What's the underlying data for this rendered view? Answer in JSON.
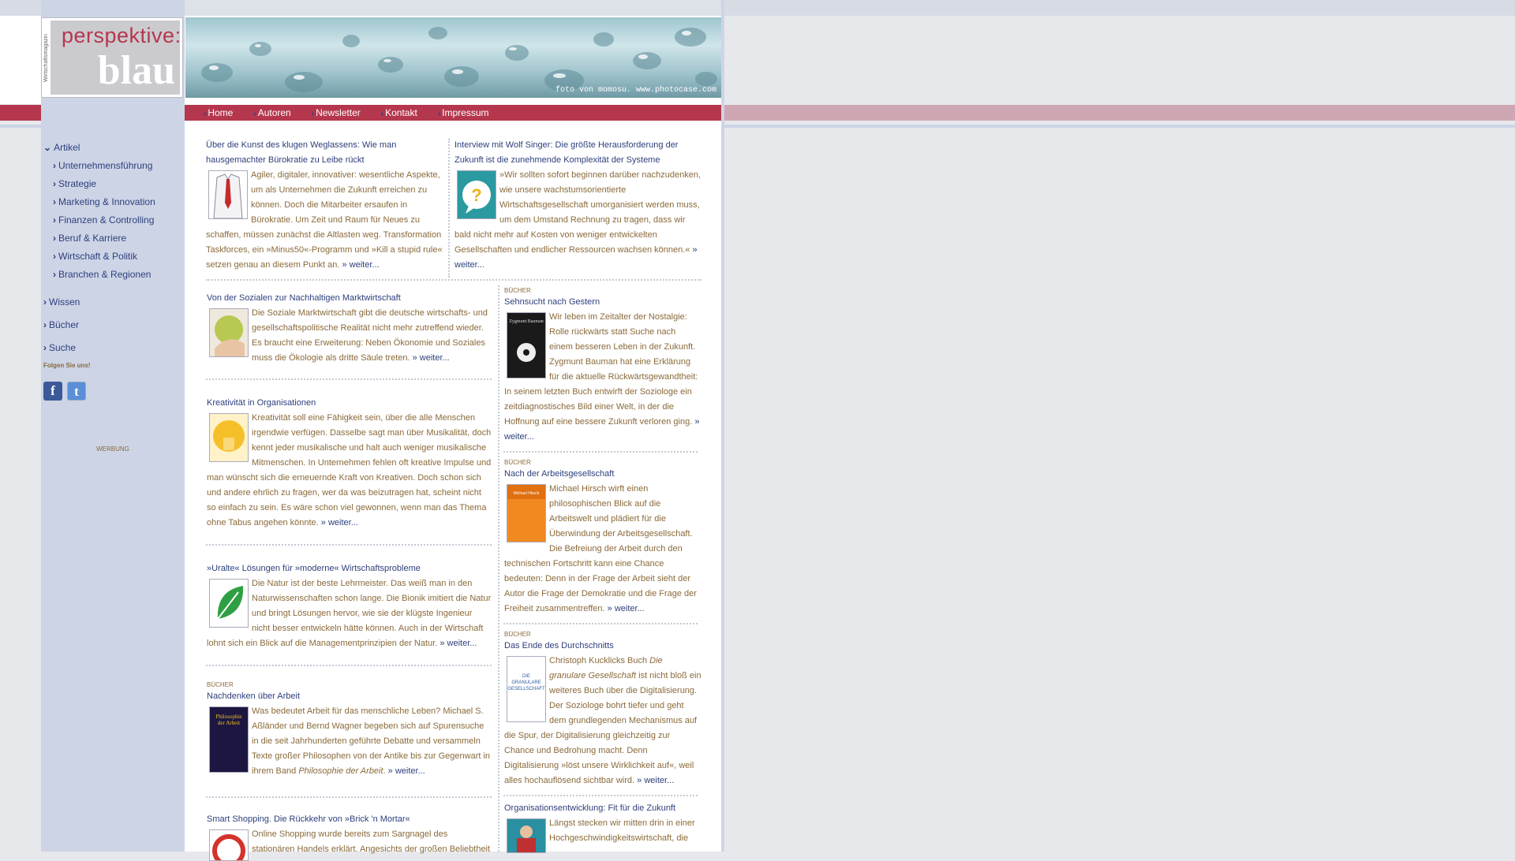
{
  "logo": {
    "side_text": "Wirtschaftsmagazin",
    "line1": "perspektive:",
    "line2": "blau"
  },
  "banner": {
    "credit": "foto von momosu. www.photocase.com"
  },
  "nav": [
    "Home",
    "Autoren",
    "Newsletter",
    "Kontakt",
    "Impressum"
  ],
  "sidebar": {
    "artikel": "Artikel",
    "sub": [
      "Unternehmensführung",
      "Strategie",
      "Marketing & Innovation",
      "Finanzen & Controlling",
      "Beruf & Karriere",
      "Wirtschaft & Politik",
      "Branchen & Regionen"
    ],
    "wissen": "Wissen",
    "buecher": "Bücher",
    "suche": "Suche",
    "follow": "Folgen Sie uns!",
    "werbung": "WERBUNG"
  },
  "articles": {
    "a1": {
      "title": "Über die Kunst des klugen Weglassens: Wie man hausgemachter Bürokratie zu Leibe rückt",
      "text": "Agiler, digitaler, innovativer: wesentliche Aspekte, um als Unternehmen die Zukunft erreichen zu können. Doch die Mitarbeiter ersaufen in Bürokratie. Um Zeit und Raum für Neues zu schaffen, müssen zunächst die Altlasten weg. Transformation Taskforces, ein »Minus50«-Programm und »Kill a stupid rule« setzen genau an diesem Punkt an.",
      "more": "weiter..."
    },
    "a2": {
      "title": "Interview mit Wolf Singer: Die größte Herausforderung der Zukunft ist die zunehmende Komplexität der Systeme",
      "text": "»Wir sollten sofort beginnen darüber nachzudenken, wie unsere wachstumsorientierte Wirtschaftsgesellschaft umorganisiert werden muss, um dem Umstand Rechnung zu tragen, dass wir bald nicht mehr auf Kosten von weniger entwickelten Gesellschaften und endlicher Ressourcen wachsen können.«",
      "more": "weiter..."
    },
    "a3": {
      "title": "Von der Sozialen zur Nachhaltigen Marktwirtschaft",
      "text": "Die Soziale Marktwirtschaft gibt die deutsche wirtschafts- und gesellschaftspolitische Realität nicht mehr zutreffend wieder. Es braucht eine Erweiterung: Neben Ökonomie und Soziales muss die Ökologie als dritte Säule treten.",
      "more": "weiter..."
    },
    "a4": {
      "title": "Kreativität in Organisationen",
      "text": "Kreativität soll eine Fähigkeit sein, über die alle Menschen irgendwie verfügen. Dasselbe sagt man über Musikalität, doch kennt jeder musikalische und halt auch weniger musikalische Mitmenschen. In Unternehmen fehlen oft kreative Impulse und man wünscht sich die erneuernde Kraft von Kreativen. Doch schon sich und andere ehrlich zu fragen, wer da was beizutragen hat, scheint nicht so einfach zu sein. Es wäre schon viel gewonnen, wenn man das Thema ohne Tabus angehen könnte.",
      "more": "weiter..."
    },
    "a5": {
      "title": "»Uralte« Lösungen für »moderne« Wirtschaftsprobleme",
      "text": "Die Natur ist der beste Lehrmeister. Das weiß man in den Naturwissenschaften schon lange. Die Bionik imitiert die Natur und bringt Lösungen hervor, wie sie der klügste Ingenieur nicht besser entwickeln hätte können. Auch in der Wirtschaft lohnt sich ein Blick auf die Managementprinzipien der Natur.",
      "more": "weiter..."
    },
    "a6": {
      "kicker": "BÜCHER",
      "title": "Nachdenken über Arbeit",
      "text": "Was bedeutet Arbeit für das menschliche Leben? Michael S. Aßländer und Bernd Wagner begeben sich auf Spurensuche in die seit Jahrhunderten geführte Debatte und versammeln Texte großer Philosophen von der Antike bis zur Gegenwart in ihrem Band",
      "book": "Philosophie der Arbeit",
      "more": "weiter..."
    },
    "a7": {
      "title": "Smart Shopping. Die Rückkehr von »Brick 'n Mortar«",
      "text": "Online Shopping wurde bereits zum Sargnagel des stationären Handels erklärt. Angesichts der großen Beliebtheit"
    },
    "b1": {
      "kicker": "BÜCHER",
      "title": "Sehnsucht nach Gestern",
      "text": "Wir leben im Zeitalter der Nostalgie: Rolle rückwärts statt Suche nach einem besseren Leben in der Zukunft. Zygmunt Bauman hat eine Erklärung für die aktuelle Rückwärtsgewandtheit: In seinem letzten Buch entwirft der Soziologe ein zeitdiagnostisches Bild einer Welt, in der die Hoffnung auf eine bessere Zukunft verloren ging.",
      "more": "weiter..."
    },
    "b2": {
      "kicker": "BÜCHER",
      "title": "Nach der Arbeitsgesellschaft",
      "text": "Michael Hirsch wirft einen philosophischen Blick auf die Arbeitswelt und plädiert für die Überwindung der Arbeitsgesellschaft. Die Befreiung der Arbeit durch den technischen Fortschritt kann eine Chance bedeuten: Denn in der Frage der Arbeit sieht der Autor die Frage der Demokratie und die Frage der Freiheit zusammentreffen.",
      "more": "weiter..."
    },
    "b3": {
      "kicker": "BÜCHER",
      "title": "Das Ende des Durchschnitts",
      "text_pre": "Christoph Kucklicks Buch",
      "book": "Die granulare Gesellschaft",
      "text": "ist nicht bloß ein weiteres Buch über die Digitalisierung. Der Soziologe bohrt tiefer und geht dem grundlegenden Mechanismus auf die Spur, der Digitalisierung gleichzeitig zur Chance und Bedrohung macht. Denn Digitalisierung »löst unsere Wirklichkeit auf«, weil alles hochauflösend sichtbar wird.",
      "more": "weiter..."
    },
    "b4": {
      "title": "Organisationsentwicklung: Fit für die Zukunft",
      "text": "Längst stecken wir mitten drin in einer Hochgeschwindigkeitswirtschaft, die"
    }
  },
  "colors": {
    "brand": "#b5374d",
    "link": "#2c3f7c",
    "text": "#8a6a3a",
    "sidebar": "#cdd4e6"
  }
}
